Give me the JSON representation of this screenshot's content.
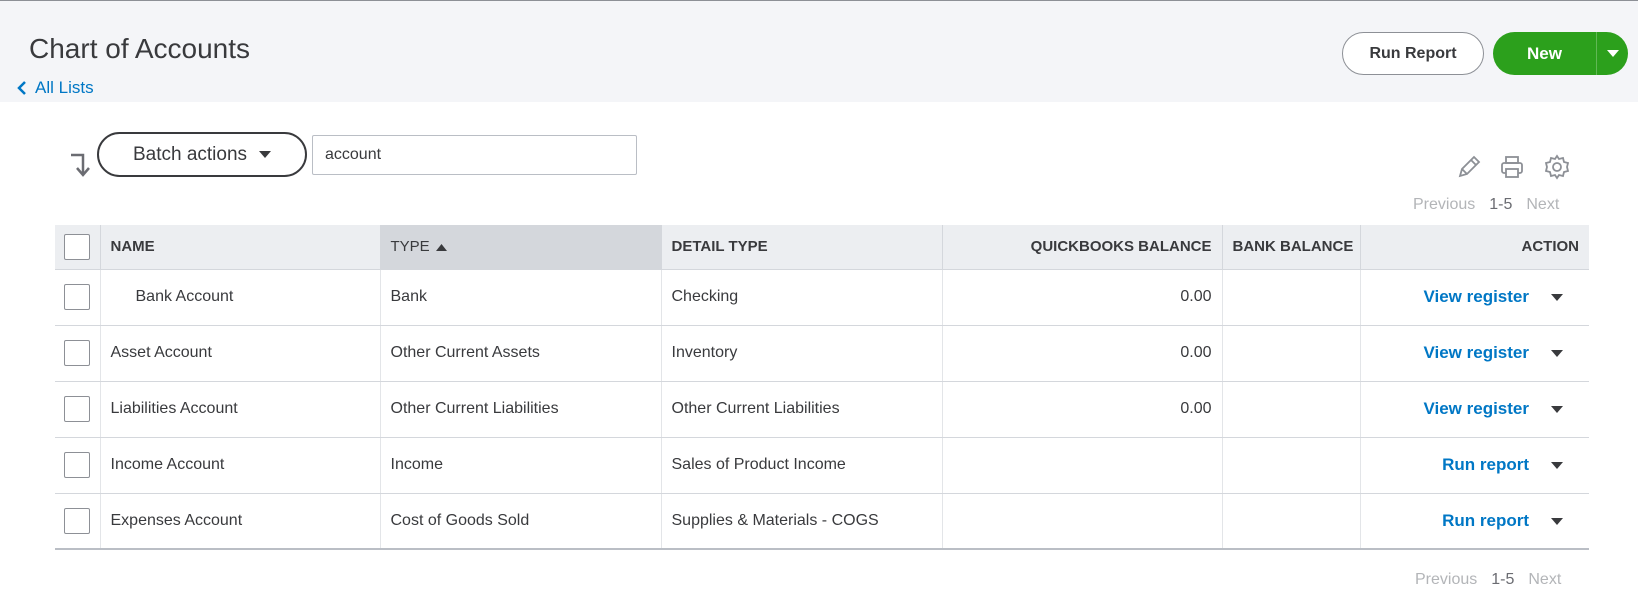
{
  "header": {
    "title": "Chart of Accounts",
    "back_link": "All Lists",
    "run_report_label": "Run Report",
    "new_label": "New"
  },
  "toolbar": {
    "batch_actions_label": "Batch actions",
    "search_value": "account",
    "icons": [
      "pencil-icon",
      "printer-icon",
      "gear-icon"
    ]
  },
  "pager": {
    "previous": "Previous",
    "range": "1-5",
    "next": "Next"
  },
  "table": {
    "columns": {
      "name": "NAME",
      "type": "TYPE",
      "detail_type": "DETAIL TYPE",
      "qb_balance": "QUICKBOOKS BALANCE",
      "bank_balance": "BANK BALANCE",
      "action": "ACTION"
    },
    "rows": [
      {
        "name": "Bank Account",
        "type": "Bank",
        "detail_type": "Checking",
        "qb_balance": "0.00",
        "bank_balance": "",
        "action": "View register"
      },
      {
        "name": "Asset Account",
        "type": "Other Current Assets",
        "detail_type": "Inventory",
        "qb_balance": "0.00",
        "bank_balance": "",
        "action": "View register"
      },
      {
        "name": "Liabilities Account",
        "type": "Other Current Liabilities",
        "detail_type": "Other Current Liabilities",
        "qb_balance": "0.00",
        "bank_balance": "",
        "action": "View register"
      },
      {
        "name": "Income Account",
        "type": "Income",
        "detail_type": "Sales of Product Income",
        "qb_balance": "",
        "bank_balance": "",
        "action": "Run report"
      },
      {
        "name": "Expenses Account",
        "type": "Cost of Goods Sold",
        "detail_type": "Supplies & Materials - COGS",
        "qb_balance": "",
        "bank_balance": "",
        "action": "Run report"
      }
    ]
  },
  "colors": {
    "primary_green": "#2ca01c",
    "link_blue": "#0077c5",
    "text": "#393a3d",
    "header_bg": "#f4f5f8"
  }
}
